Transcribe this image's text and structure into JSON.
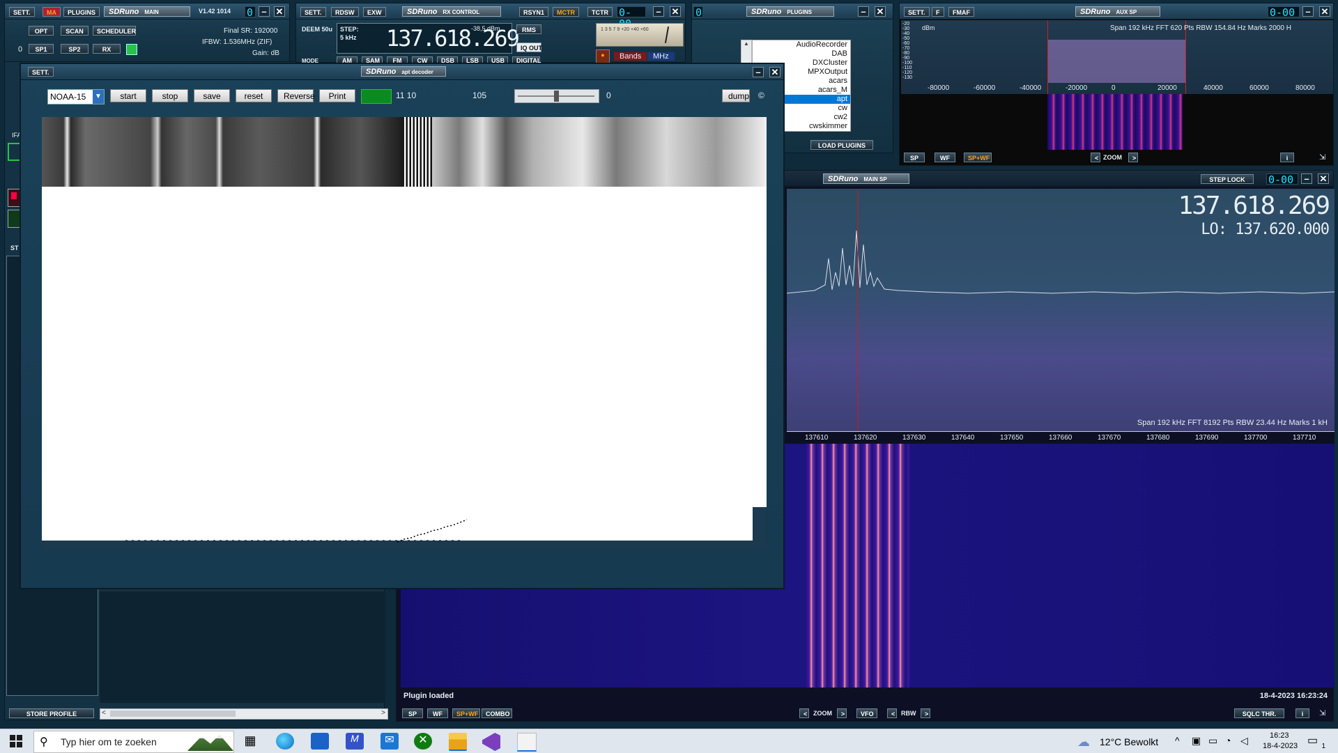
{
  "main_win": {
    "sett": "SETT.",
    "ma": "MA",
    "plugins": "PLUGINS",
    "brand": "SDRuno",
    "title": "MAIN",
    "version": "V1.42 1014",
    "seg": "0",
    "opt": "OPT",
    "scan": "SCAN",
    "scheduler": "SCHEDULER",
    "zero": "0",
    "sp1": "SP1",
    "sp2": "SP2",
    "rx": "RX",
    "final_sr": "Final SR: 192000",
    "ifbw": "IFBW: 1.536MHz (ZIF)",
    "gain": "Gain: dB",
    "ifa": "IFA",
    "st": "ST",
    "store_profile": "STORE PROFILE"
  },
  "rx_control": {
    "sett": "SETT.",
    "rdsw": "RDSW",
    "exw": "EXW",
    "brand": "SDRuno",
    "title": "RX CONTROL",
    "rsyn1": "RSYN1",
    "mctr": "MCTR",
    "tctr": "TCTR",
    "seg": "0-00",
    "deem": "DEEM 50u",
    "step": "STEP:",
    "step_val": "5 kHz",
    "freq": "137.618.269",
    "dbm": "-38,5 dBm",
    "rms": "RMS",
    "iq_out": "IQ OUT",
    "mode": "MODE",
    "modes": [
      "AM",
      "SAM",
      "FM",
      "CW",
      "DSB",
      "LSB",
      "USB",
      "DIGITAL"
    ],
    "bands": "Bands",
    "mhz": "MHz",
    "meter_scale": "1 3 5 7 9 +20 +40 +60"
  },
  "plugins_win": {
    "seg": "0",
    "brand": "SDRuno",
    "title": "PLUGINS",
    "load": "LOAD PLUGINS",
    "items": [
      "AudioRecorder",
      "DAB",
      "DXCluster",
      "MPXOutput",
      "acars",
      "acars_M",
      "apt",
      "cw",
      "cw2",
      "cwskimmer"
    ],
    "selected": "apt"
  },
  "aux_sp": {
    "sett": "SETT.",
    "f": "F",
    "fmaf": "FMAF",
    "brand": "SDRuno",
    "title": "AUX SP",
    "seg": "0-00",
    "dbm": "dBm",
    "info": "Span 192 kHz   FFT 620 Pts   RBW 154.84 Hz   Marks 2000 H",
    "yticks": [
      "-20",
      "-30",
      "-40",
      "-50",
      "-60",
      "-70",
      "-80",
      "-90",
      "-100",
      "-110",
      "-120",
      "-130"
    ],
    "xticks": [
      "-80000",
      "-60000",
      "-40000",
      "-20000",
      "0",
      "20000",
      "40000",
      "60000",
      "80000"
    ],
    "sp": "SP",
    "wf": "WF",
    "spwf": "SP+WF",
    "zoom": "ZOOM",
    "i": "i"
  },
  "main_sp": {
    "brand": "SDRuno",
    "title": "MAIN SP",
    "step_lock": "STEP LOCK",
    "seg": "0-00",
    "freq": "137.618.269",
    "lo": "LO: 137.620.000",
    "info": "Span 192 kHz   FFT 8192 Pts   RBW 23.44 Hz   Marks 1 kH",
    "xticks": [
      "137610",
      "137620",
      "137630",
      "137640",
      "137650",
      "137660",
      "137670",
      "137680",
      "137690",
      "137700",
      "137710"
    ],
    "status": "Plugin loaded",
    "datetime": "18-4-2023 16:23:24",
    "sp": "SP",
    "wf": "WF",
    "spwf": "SP+WF",
    "combo": "COMBO",
    "zoom": "ZOOM",
    "vfo": "VFO",
    "rbw": "RBW",
    "sqlc": "SQLC THR.",
    "i": "i"
  },
  "apt": {
    "sett": "SETT.",
    "brand": "SDRuno",
    "title": "apt decoder",
    "satellite": "NOAA-15",
    "start": "start",
    "stop": "stop",
    "save": "save",
    "reset": "reset",
    "reverse": "Reverse",
    "print": "Print",
    "time": "11 10",
    "count": "105",
    "slider_val": "0",
    "dump": "dump",
    "copy": "©",
    "slider_fraction": 0.5
  },
  "taskbar": {
    "search": "Typ hier om te zoeken",
    "weather": "12°C  Bewolkt",
    "time": "16:23",
    "date": "18-4-2023",
    "badge": "1"
  }
}
